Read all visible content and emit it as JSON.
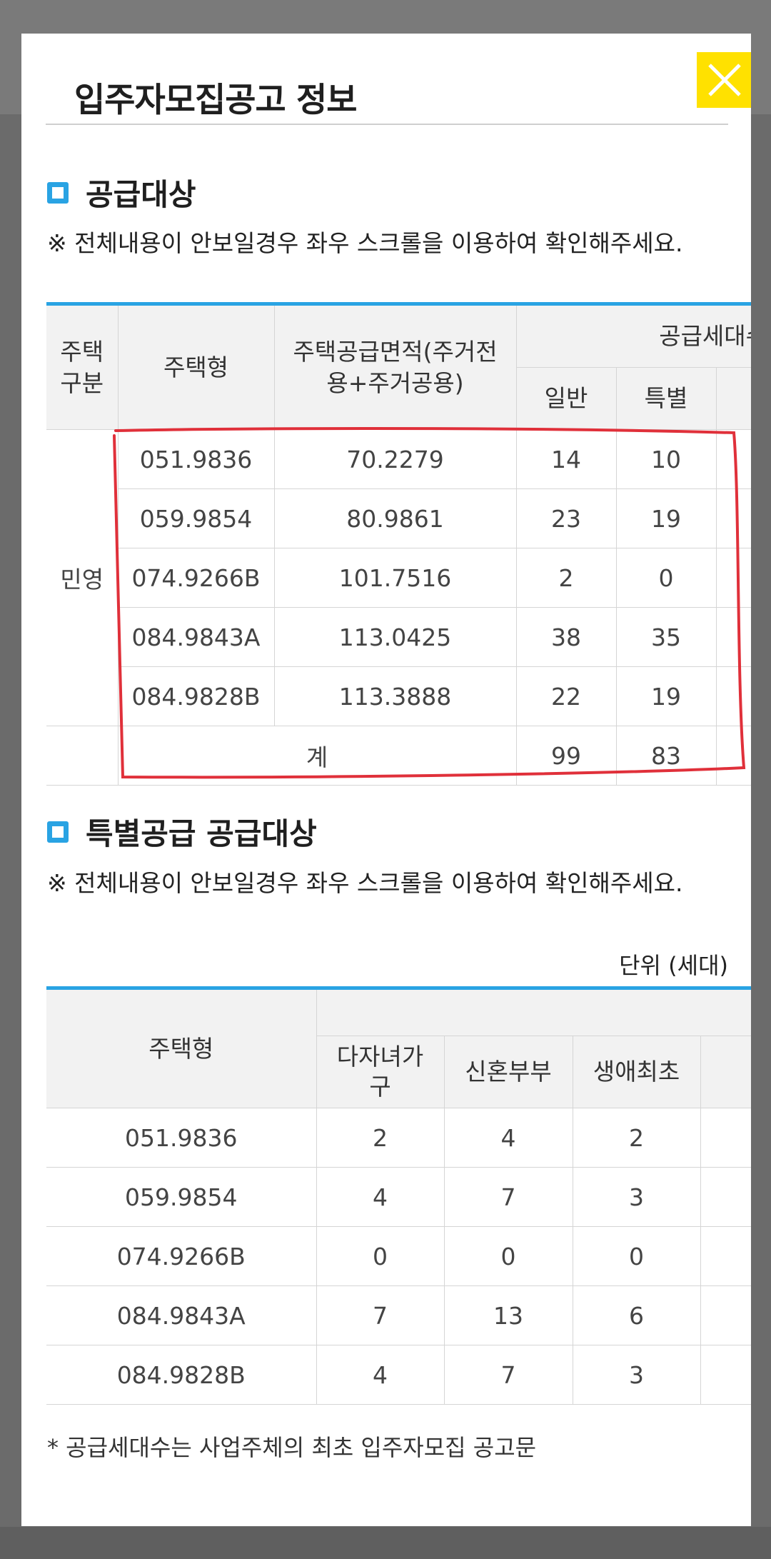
{
  "modal": {
    "title": "입주자모집공고 정보",
    "close_icon": "close-icon"
  },
  "supply": {
    "title": "공급대상",
    "notice": "※ 전체내용이 안보일경우 좌우 스크롤을 이용하여 확인해주세요.",
    "headers": {
      "house_category": "주택구분",
      "house_type": "주택형",
      "area": "주택공급면적(주거전용+주거공용)",
      "households": "공급세대수",
      "general": "일반",
      "special": "특별"
    },
    "category": "민영",
    "rows": [
      {
        "type": "051.9836",
        "area": "70.2279",
        "general": "14",
        "special": "10"
      },
      {
        "type": "059.9854",
        "area": "80.9861",
        "general": "23",
        "special": "19"
      },
      {
        "type": "074.9266B",
        "area": "101.7516",
        "general": "2",
        "special": "0"
      },
      {
        "type": "084.9843A",
        "area": "113.0425",
        "general": "38",
        "special": "35"
      },
      {
        "type": "084.9828B",
        "area": "113.3888",
        "general": "22",
        "special": "19"
      }
    ],
    "total": {
      "label": "계",
      "general": "99",
      "special": "83"
    }
  },
  "special_supply": {
    "title": "특별공급 공급대상",
    "notice": "※ 전체내용이 안보일경우 좌우 스크롤을 이용하여 확인해주세요.",
    "unit": "단위 (세대)",
    "headers": {
      "house_type": "주택형",
      "multi_child": "다자녀가구",
      "newlywed": "신혼부부",
      "first_life": "생애최초"
    },
    "rows": [
      {
        "type": "051.9836",
        "multi_child": "2",
        "newlywed": "4",
        "first_life": "2"
      },
      {
        "type": "059.9854",
        "multi_child": "4",
        "newlywed": "7",
        "first_life": "3"
      },
      {
        "type": "074.9266B",
        "multi_child": "0",
        "newlywed": "0",
        "first_life": "0"
      },
      {
        "type": "084.9843A",
        "multi_child": "7",
        "newlywed": "13",
        "first_life": "6"
      },
      {
        "type": "084.9828B",
        "multi_child": "4",
        "newlywed": "7",
        "first_life": "3"
      }
    ],
    "footnote": "* 공급세대수는 사업주체의 최초 입주자모집 공고문"
  },
  "colors": {
    "accent": "#29a3e3",
    "close_bg": "#ffe100",
    "annotation": "#e0303a"
  }
}
